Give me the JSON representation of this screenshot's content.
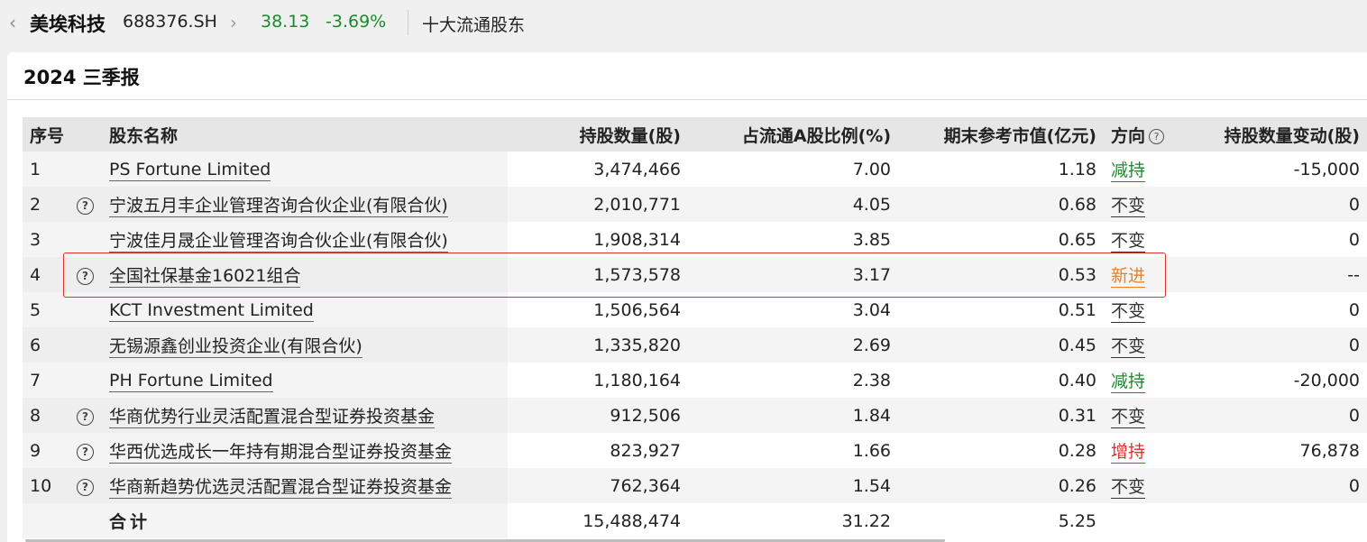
{
  "header": {
    "back_glyph": "‹",
    "stock_name": "美埃科技",
    "stock_code": "688376.SH",
    "chevron_glyph": "›",
    "price": "38.13",
    "change_pct": "-3.69%",
    "section": "十大流通股东"
  },
  "report": {
    "title": "2024 三季报"
  },
  "table": {
    "columns": [
      "序号",
      "股东名称",
      "持股数量(股)",
      "占流通A股比例(%)",
      "期末参考市值(亿元)",
      "方向",
      "持股数量变动(股)"
    ],
    "rows": [
      {
        "idx": "1",
        "has_info": false,
        "name": "PS Fortune Limited",
        "shares": "3,474,466",
        "ratio": "7.00",
        "value": "1.18",
        "direction": "减持",
        "direction_color": "#1a8a2c",
        "change": "-15,000"
      },
      {
        "idx": "2",
        "has_info": true,
        "name": "宁波五月丰企业管理咨询合伙企业(有限合伙)",
        "shares": "2,010,771",
        "ratio": "4.05",
        "value": "0.68",
        "direction": "不变",
        "direction_color": "#333333",
        "change": "0"
      },
      {
        "idx": "3",
        "has_info": false,
        "name": "宁波佳月晟企业管理咨询合伙企业(有限合伙)",
        "shares": "1,908,314",
        "ratio": "3.85",
        "value": "0.65",
        "direction": "不变",
        "direction_color": "#333333",
        "change": "0"
      },
      {
        "idx": "4",
        "has_info": true,
        "name": "全国社保基金16021组合",
        "shares": "1,573,578",
        "ratio": "3.17",
        "value": "0.53",
        "direction": "新进",
        "direction_color": "#e8822a",
        "change": "--"
      },
      {
        "idx": "5",
        "has_info": false,
        "name": "KCT Investment Limited",
        "shares": "1,506,564",
        "ratio": "3.04",
        "value": "0.51",
        "direction": "不变",
        "direction_color": "#333333",
        "change": "0"
      },
      {
        "idx": "6",
        "has_info": false,
        "name": "无锡源鑫创业投资企业(有限合伙)",
        "shares": "1,335,820",
        "ratio": "2.69",
        "value": "0.45",
        "direction": "不变",
        "direction_color": "#333333",
        "change": "0"
      },
      {
        "idx": "7",
        "has_info": false,
        "name": "PH Fortune Limited",
        "shares": "1,180,164",
        "ratio": "2.38",
        "value": "0.40",
        "direction": "减持",
        "direction_color": "#1a8a2c",
        "change": "-20,000"
      },
      {
        "idx": "8",
        "has_info": true,
        "name": "华商优势行业灵活配置混合型证券投资基金",
        "shares": "912,506",
        "ratio": "1.84",
        "value": "0.31",
        "direction": "不变",
        "direction_color": "#333333",
        "change": "0"
      },
      {
        "idx": "9",
        "has_info": true,
        "name": "华西优选成长一年持有期混合型证券投资基金",
        "shares": "823,927",
        "ratio": "1.66",
        "value": "0.28",
        "direction": "增持",
        "direction_color": "#e0302a",
        "change": "76,878"
      },
      {
        "idx": "10",
        "has_info": true,
        "name": "华商新趋势优选灵活配置混合型证券投资基金",
        "shares": "762,364",
        "ratio": "1.54",
        "value": "0.26",
        "direction": "不变",
        "direction_color": "#333333",
        "change": "0"
      }
    ],
    "total": {
      "label": "合计",
      "shares": "15,488,474",
      "ratio": "31.22",
      "value": "5.25"
    }
  },
  "icons": {
    "info": "?",
    "highlight_color": "#e0302a"
  }
}
